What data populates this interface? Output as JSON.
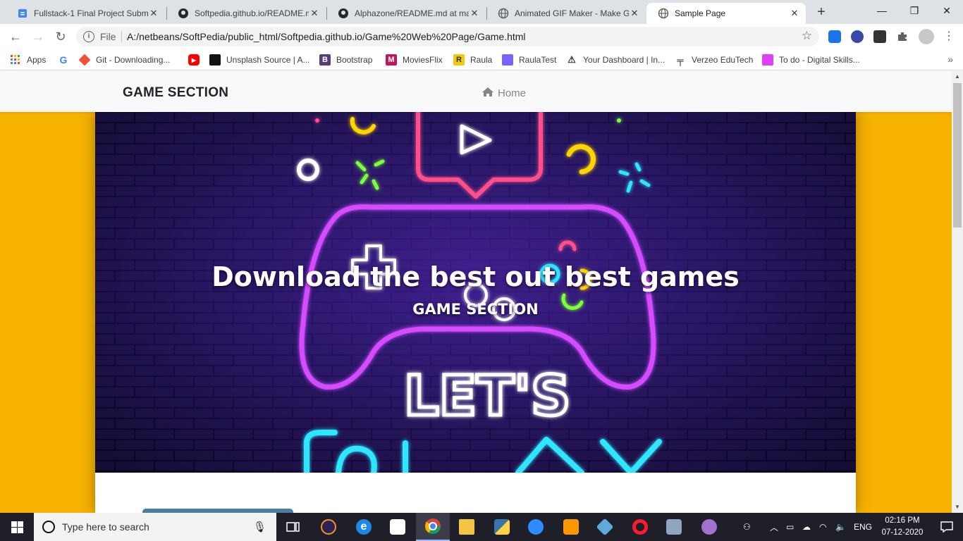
{
  "browser": {
    "tabs": [
      {
        "title": "Fullstack-1 Final Project Submi",
        "icon": "doc-blue-icon",
        "active": false
      },
      {
        "title": "Softpedia.github.io/README.m",
        "icon": "github-icon",
        "active": false
      },
      {
        "title": "Alphazone/README.md at ma",
        "icon": "github-icon",
        "active": false
      },
      {
        "title": "Animated GIF Maker - Make G",
        "icon": "globe-icon",
        "active": false
      },
      {
        "title": "Sample Page",
        "icon": "globe-icon",
        "active": true
      }
    ],
    "new_tab": "+",
    "window_controls": {
      "minimize": "—",
      "restore": "❐",
      "close": "✕"
    },
    "toolbar": {
      "back": "←",
      "forward": "→",
      "reload": "↻",
      "scheme_label": "File",
      "url": "A:/netbeans/SoftPedia/public_html/Softpedia.github.io/Game%20Web%20Page/Game.html",
      "star": "☆"
    },
    "bookmarks": [
      {
        "label": "Apps",
        "icon": "apps-grid-icon",
        "color": "#ea4335"
      },
      {
        "label": "",
        "icon": "google-icon",
        "color": "#4285f4"
      },
      {
        "label": "Git - Downloading...",
        "icon": "git-icon",
        "color": "#f05033"
      },
      {
        "label": "",
        "icon": "youtube-icon",
        "color": "#ff0000"
      },
      {
        "label": "Unsplash Source | A...",
        "icon": "unsplash-icon",
        "color": "#111111"
      },
      {
        "label": "Bootstrap",
        "icon": "bootstrap-icon",
        "color": "#563d7c"
      },
      {
        "label": "MoviesFlix",
        "icon": "moviesflix-icon",
        "color": "#c2185b"
      },
      {
        "label": "Raula",
        "icon": "raula-icon",
        "color": "#f2c811"
      },
      {
        "label": "RaulaTest",
        "icon": "raulatest-icon",
        "color": "#7b61ff"
      },
      {
        "label": "Your Dashboard | In...",
        "icon": "dashboard-icon",
        "color": "#333333"
      },
      {
        "label": "Verzeo EduTech",
        "icon": "verzeo-icon",
        "color": "#111111"
      },
      {
        "label": "To do - Digital Skills...",
        "icon": "todo-icon",
        "color": "#e040fb"
      }
    ],
    "bookmarks_more": "»"
  },
  "page": {
    "brand": "GAME SECTION",
    "nav_home": "Home",
    "hero_heading": "Download the best out best games",
    "hero_subheading": "GAME SECTION",
    "background_color": "#f7b100"
  },
  "taskbar": {
    "search_placeholder": "Type here to search",
    "language": "ENG",
    "time": "02:16 PM",
    "date": "07-12-2020"
  }
}
